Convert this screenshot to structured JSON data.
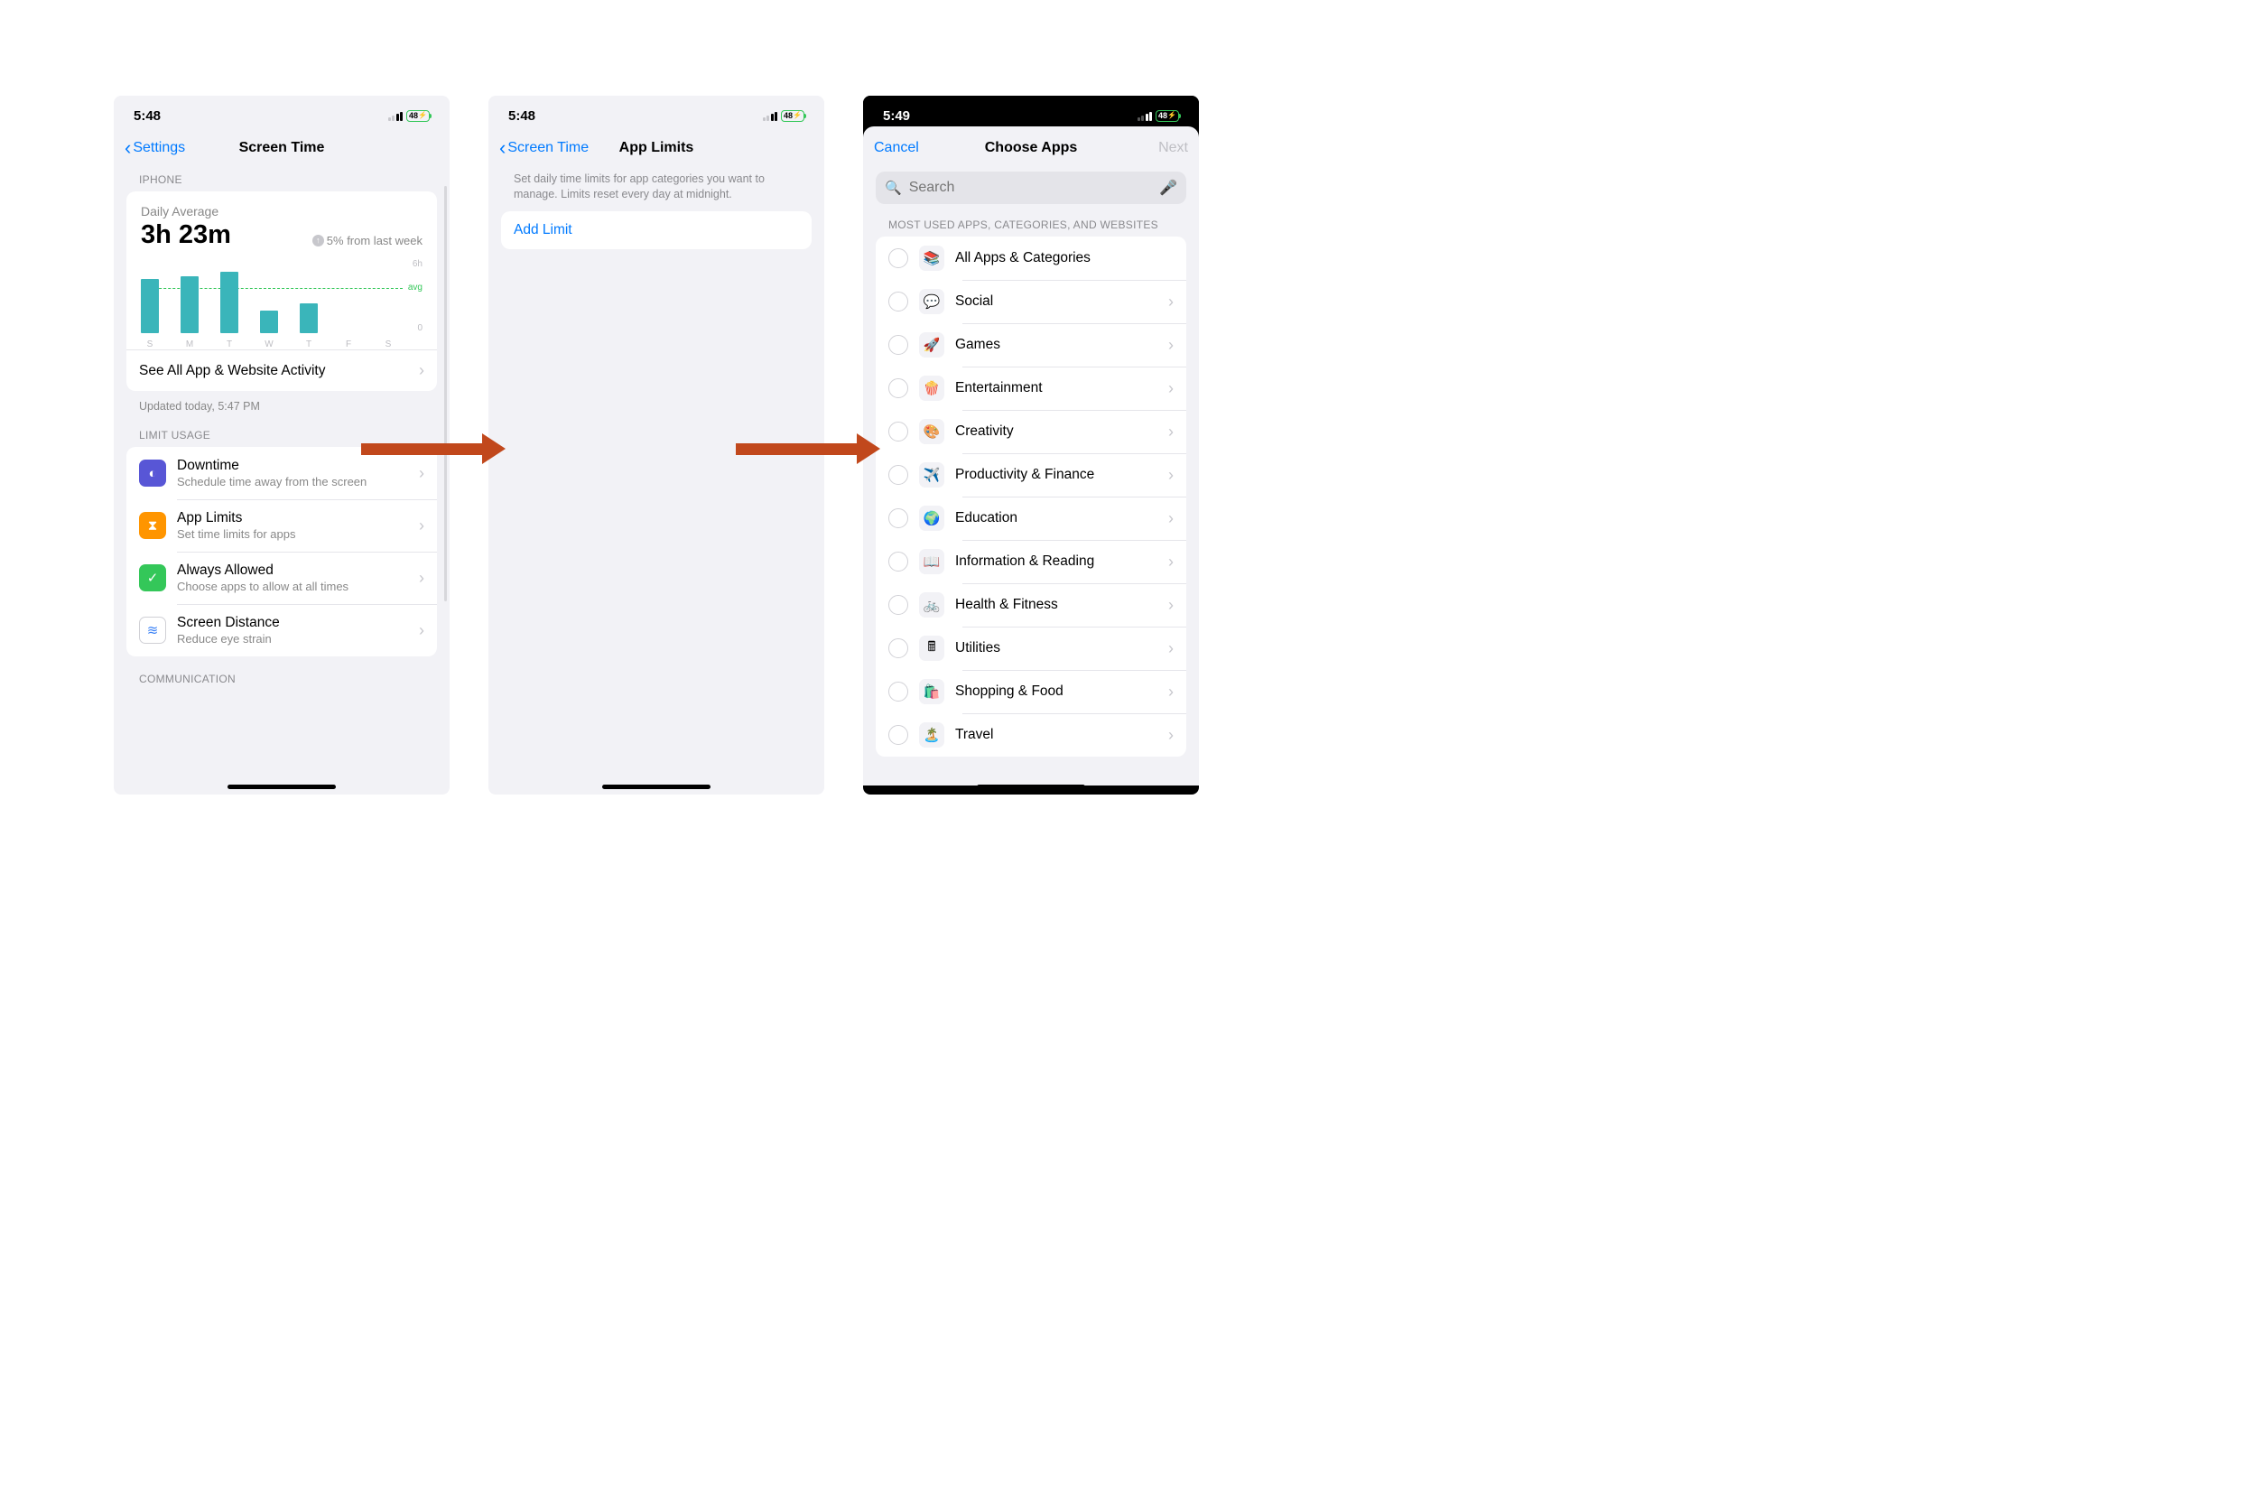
{
  "status": {
    "time_a": "5:48",
    "time_b": "5:49",
    "battery": "48"
  },
  "screen1": {
    "back": "Settings",
    "title": "Screen Time",
    "section_iphone": "IPHONE",
    "daily_avg_label": "Daily Average",
    "daily_avg_value": "3h 23m",
    "delta_text": "5% from last week",
    "chart_ytop": "6h",
    "chart_ybot": "0",
    "chart_avg": "avg",
    "see_all": "See All App & Website Activity",
    "updated": "Updated today, 5:47 PM",
    "section_limit": "LIMIT USAGE",
    "rows": [
      {
        "title": "Downtime",
        "sub": "Schedule time away from the screen",
        "icon": "moon",
        "color": "#5856d6"
      },
      {
        "title": "App Limits",
        "sub": "Set time limits for apps",
        "icon": "hourglass",
        "color": "#ff9500"
      },
      {
        "title": "Always Allowed",
        "sub": "Choose apps to allow at all times",
        "icon": "check",
        "color": "#34c759"
      },
      {
        "title": "Screen Distance",
        "sub": "Reduce eye strain",
        "icon": "distance",
        "color": "#ffffff"
      }
    ],
    "section_comm": "COMMUNICATION"
  },
  "screen2": {
    "back": "Screen Time",
    "title": "App Limits",
    "desc": "Set daily time limits for app categories you want to manage. Limits reset every day at midnight.",
    "add": "Add Limit"
  },
  "screen3": {
    "cancel": "Cancel",
    "title": "Choose Apps",
    "next": "Next",
    "search_ph": "Search",
    "section": "MOST USED APPS, CATEGORIES, AND WEBSITES",
    "cats": [
      {
        "label": "All Apps & Categories",
        "emoji": "📚",
        "chev": false
      },
      {
        "label": "Social",
        "emoji": "💬",
        "chev": true
      },
      {
        "label": "Games",
        "emoji": "🚀",
        "chev": true
      },
      {
        "label": "Entertainment",
        "emoji": "🍿",
        "chev": true
      },
      {
        "label": "Creativity",
        "emoji": "🎨",
        "chev": true
      },
      {
        "label": "Productivity & Finance",
        "emoji": "✈️",
        "chev": true
      },
      {
        "label": "Education",
        "emoji": "🌍",
        "chev": true
      },
      {
        "label": "Information & Reading",
        "emoji": "📖",
        "chev": true
      },
      {
        "label": "Health & Fitness",
        "emoji": "🚲",
        "chev": true
      },
      {
        "label": "Utilities",
        "emoji": "🖩",
        "chev": true
      },
      {
        "label": "Shopping & Food",
        "emoji": "🛍️",
        "chev": true
      },
      {
        "label": "Travel",
        "emoji": "🏝️",
        "chev": true
      }
    ]
  },
  "chart_data": {
    "type": "bar",
    "title": "Daily Average",
    "ylabel": "hours",
    "ylim": [
      0,
      6
    ],
    "avg_hours": 3.38,
    "categories": [
      "S",
      "M",
      "T",
      "W",
      "T",
      "F",
      "S"
    ],
    "values": [
      4.4,
      4.6,
      5.0,
      1.8,
      2.4,
      0,
      0
    ]
  }
}
